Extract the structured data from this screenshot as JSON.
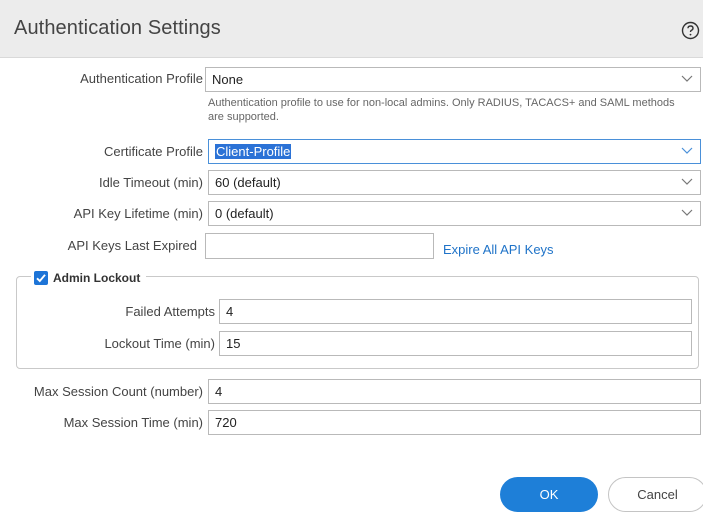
{
  "dialog": {
    "title": "Authentication Settings",
    "help_icon": "help-circle-icon"
  },
  "form": {
    "auth_profile": {
      "label": "Authentication Profile",
      "value": "None",
      "hint": "Authentication profile to use for non-local admins. Only RADIUS, TACACS+ and SAML methods are supported."
    },
    "cert_profile": {
      "label": "Certificate Profile",
      "value": "Client-Profile"
    },
    "idle_timeout": {
      "label": "Idle Timeout (min)",
      "value": "60 (default)"
    },
    "api_key_lifetime": {
      "label": "API Key Lifetime (min)",
      "value": "0 (default)"
    },
    "api_keys_last_expired": {
      "label": "API Keys Last Expired",
      "value": "",
      "link": "Expire All API Keys"
    },
    "admin_lockout": {
      "label": "Admin Lockout",
      "checked": true,
      "failed_attempts": {
        "label": "Failed Attempts",
        "value": "4"
      },
      "lockout_time": {
        "label": "Lockout Time (min)",
        "value": "15"
      }
    },
    "max_session_count": {
      "label": "Max Session Count (number)",
      "value": "4"
    },
    "max_session_time": {
      "label": "Max Session Time (min)",
      "value": "720"
    }
  },
  "buttons": {
    "ok": "OK",
    "cancel": "Cancel"
  },
  "colors": {
    "accent": "#1e7fd8",
    "link": "#1f73c8",
    "selection": "#2b72d6"
  }
}
